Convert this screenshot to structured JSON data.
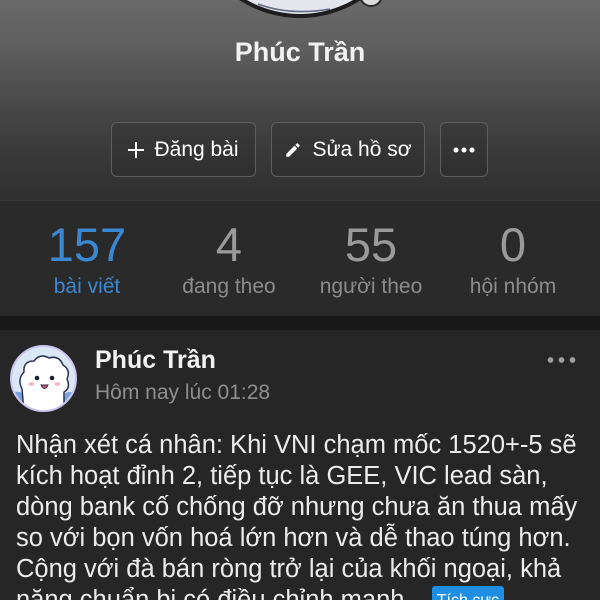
{
  "profile": {
    "name": "Phúc Trần",
    "actions": {
      "new_post_label": "Đăng bài",
      "edit_profile_label": "Sửa hồ sơ"
    },
    "stats": [
      {
        "value": 157,
        "label": "bài viết",
        "active": true
      },
      {
        "value": 4,
        "label": "đang theo",
        "active": false
      },
      {
        "value": 55,
        "label": "người theo",
        "active": false
      },
      {
        "value": 0,
        "label": "hội nhóm",
        "active": false
      }
    ]
  },
  "post": {
    "author": "Phúc Trần",
    "timestamp": "Hôm nay lúc 01:28",
    "body_lines": [
      "Nhận xét cá nhân: Khi VNI chạm mốc 1520+-5 sẽ",
      "kích hoạt đỉnh 2, tiếp tục là GEE, VIC lead sàn,",
      "dòng bank cố chống đỡ nhưng chưa ăn thua mấy",
      "so với bọn vốn hoá lớn hơn và dễ thao túng hơn.",
      "Cộng với đà bán ròng trở lại của khối ngoại, khả",
      "năng chuẩn bị có điều chỉnh mạnh..."
    ],
    "sentiment_tag": "Tích cực"
  },
  "icons": {
    "new_post": "plus-icon",
    "edit_profile": "pencil-icon",
    "profile_more": "more-horizontal-icon",
    "post_more": "more-horizontal-icon"
  },
  "colors": {
    "accent": "#3a88d2",
    "sentiment_tag": "#1f8fe3",
    "text_primary": "#f2f2f2",
    "text_secondary": "#8e8e8e"
  }
}
